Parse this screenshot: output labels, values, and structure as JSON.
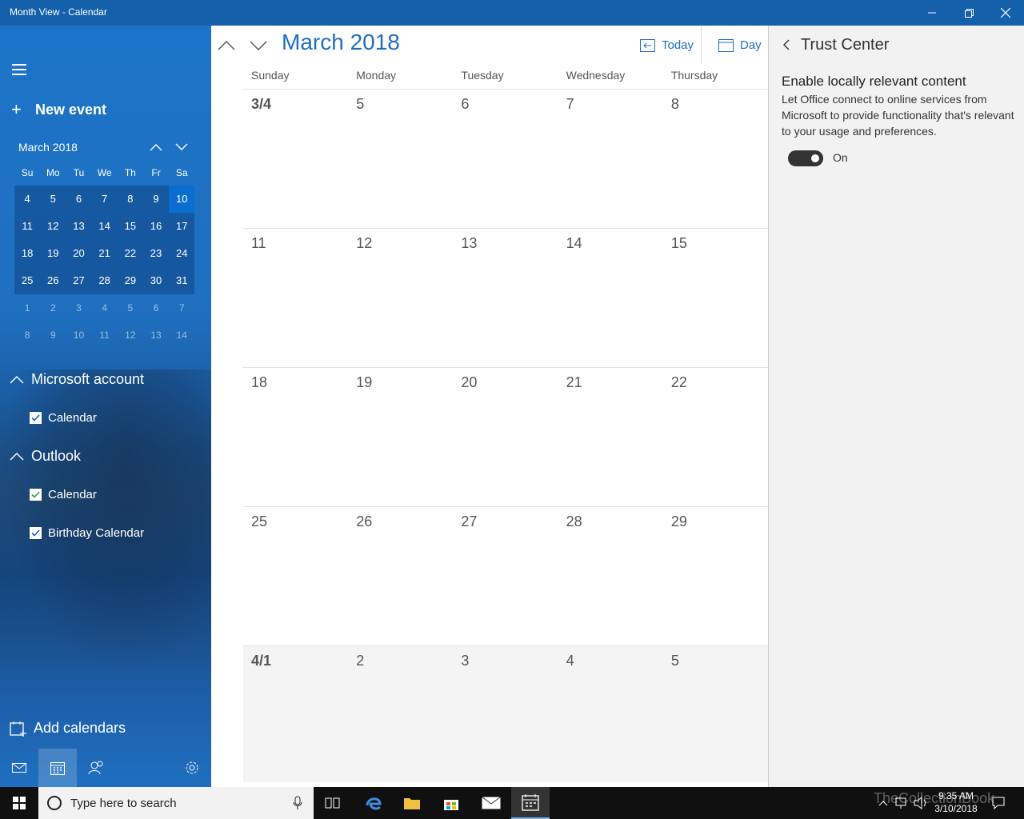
{
  "window": {
    "title": "Month View - Calendar",
    "minimize_icon": "minimize-icon",
    "restore_icon": "restore-icon",
    "close_icon": "close-icon"
  },
  "sidebar": {
    "new_event_label": "New event",
    "mini_calendar": {
      "month_label": "March 2018",
      "day_headers": [
        "Su",
        "Mo",
        "Tu",
        "We",
        "Th",
        "Fr",
        "Sa"
      ],
      "weeks": [
        [
          "4",
          "5",
          "6",
          "7",
          "8",
          "9",
          "10"
        ],
        [
          "11",
          "12",
          "13",
          "14",
          "15",
          "16",
          "17"
        ],
        [
          "18",
          "19",
          "20",
          "21",
          "22",
          "23",
          "24"
        ],
        [
          "25",
          "26",
          "27",
          "28",
          "29",
          "30",
          "31"
        ],
        [
          "1",
          "2",
          "3",
          "4",
          "5",
          "6",
          "7"
        ],
        [
          "8",
          "9",
          "10",
          "11",
          "12",
          "13",
          "14"
        ]
      ],
      "selected_day": "10"
    },
    "accounts": [
      {
        "name": "Microsoft account",
        "calendars": [
          {
            "label": "Calendar",
            "checked": true,
            "color": "#ffffff"
          }
        ]
      },
      {
        "name": "Outlook",
        "calendars": [
          {
            "label": "Calendar",
            "checked": true,
            "color": "#2e9e3e"
          },
          {
            "label": "Birthday Calendar",
            "checked": true,
            "color": "#ffffff"
          }
        ]
      }
    ],
    "add_calendars_label": "Add calendars"
  },
  "main": {
    "month_title": "March 2018",
    "today_label": "Today",
    "day_label": "Day",
    "weekday_headers": [
      "Sunday",
      "Monday",
      "Tuesday",
      "Wednesday",
      "Thursday"
    ],
    "weeks": [
      [
        "3/4",
        "5",
        "6",
        "7",
        "8"
      ],
      [
        "11",
        "12",
        "13",
        "14",
        "15"
      ],
      [
        "18",
        "19",
        "20",
        "21",
        "22"
      ],
      [
        "25",
        "26",
        "27",
        "28",
        "29"
      ],
      [
        "4/1",
        "2",
        "3",
        "4",
        "5"
      ]
    ]
  },
  "panel": {
    "title": "Trust Center",
    "heading": "Enable locally relevant content",
    "description": "Let Office connect to online services from Microsoft to provide functionality that's relevant to your usage and preferences.",
    "toggle_label": "On",
    "toggle_on": true
  },
  "taskbar": {
    "search_placeholder": "Type here to search",
    "time": "9:35 AM",
    "date": "3/10/2018",
    "watermark": "TheCollectionBook"
  },
  "colors": {
    "accent": "#1f6fc0",
    "titlebar": "#1460aa",
    "selected_day": "#0a6ed1"
  }
}
